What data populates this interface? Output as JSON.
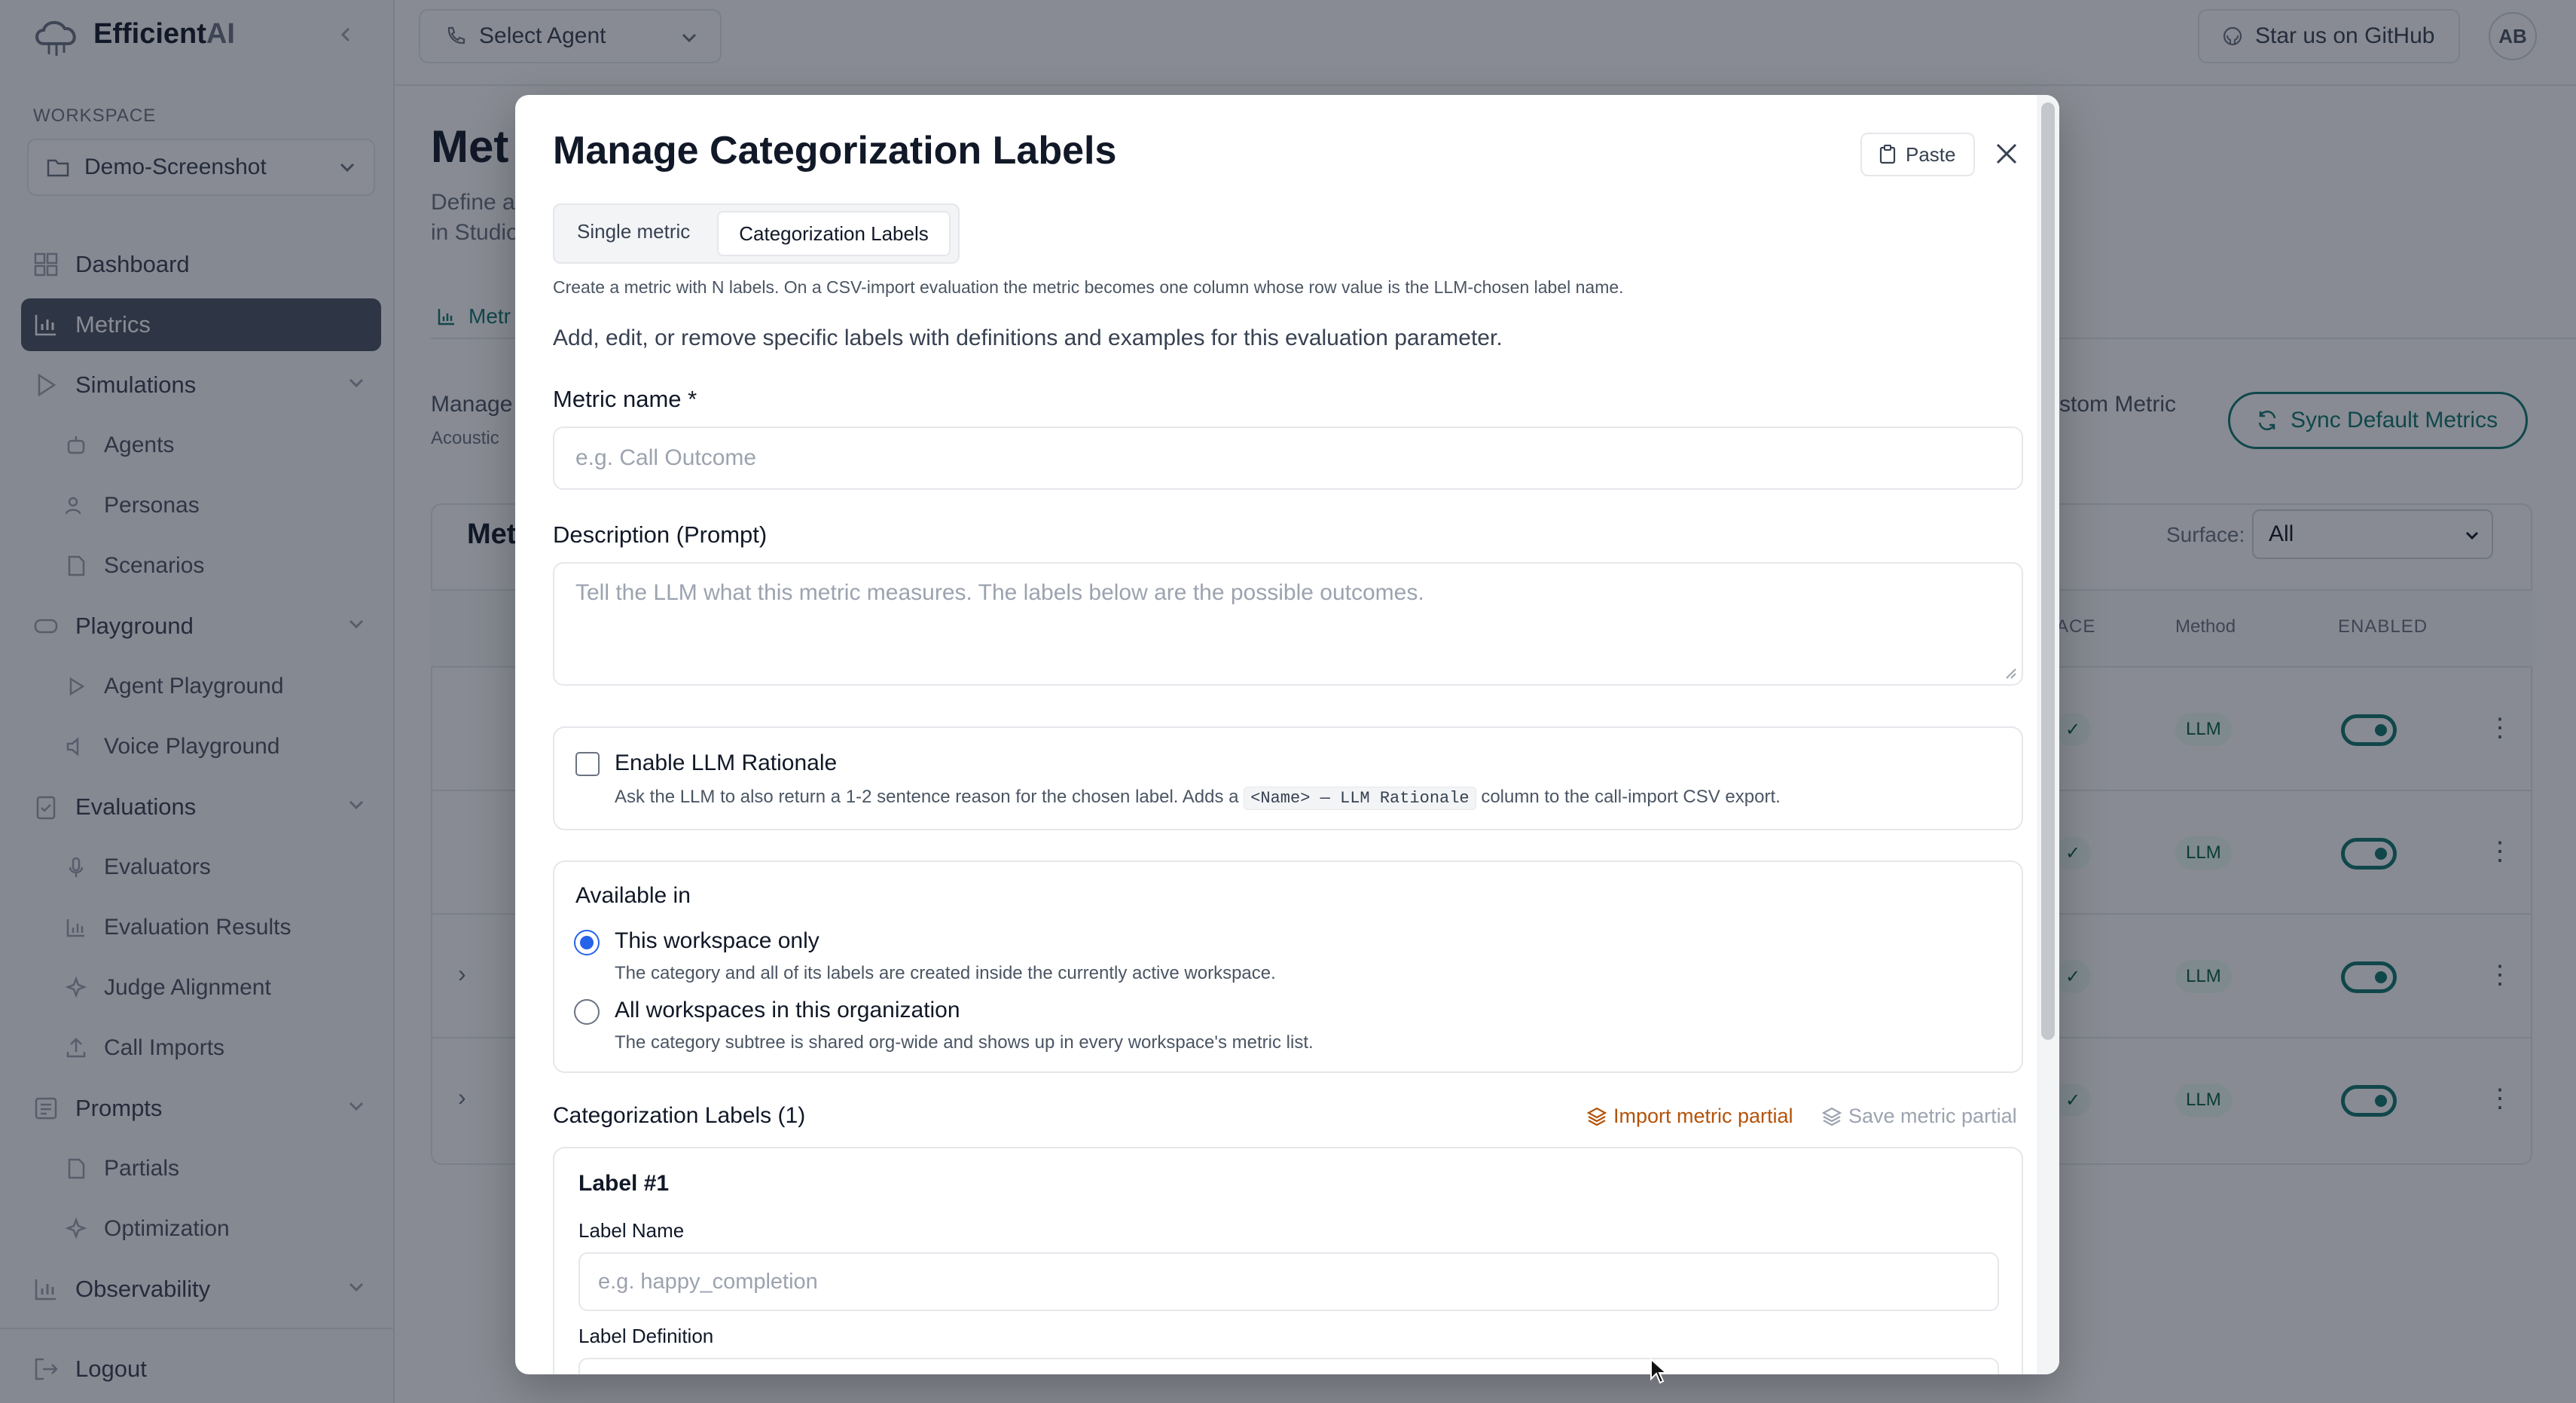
{
  "app": {
    "logo_main": "Efficient",
    "logo_accent": "AI"
  },
  "topbar": {
    "select_agent": "Select Agent",
    "github": "Star us on GitHub",
    "avatar": "AB"
  },
  "sidebar": {
    "workspace_label": "WORKSPACE",
    "workspace_value": "Demo-Screenshot",
    "items": [
      {
        "label": "Dashboard"
      },
      {
        "label": "Metrics"
      },
      {
        "label": "Simulations"
      },
      {
        "label": "Agents"
      },
      {
        "label": "Personas"
      },
      {
        "label": "Scenarios"
      },
      {
        "label": "Playground"
      },
      {
        "label": "Agent Playground"
      },
      {
        "label": "Voice Playground"
      },
      {
        "label": "Evaluations"
      },
      {
        "label": "Evaluators"
      },
      {
        "label": "Evaluation Results"
      },
      {
        "label": "Judge Alignment"
      },
      {
        "label": "Call Imports"
      },
      {
        "label": "Prompts"
      },
      {
        "label": "Partials"
      },
      {
        "label": "Optimization"
      },
      {
        "label": "Observability"
      }
    ],
    "logout": "Logout"
  },
  "page": {
    "title_partial": "Met",
    "desc_line1": "Define a",
    "desc_line2": "in Studio",
    "tab_partial": "Metr",
    "manage_partial": "Manage",
    "acoustic_partial": "Acoustic",
    "section_partial": "Met",
    "custom_metric_partial": "stom Metric",
    "sync_button": "Sync Default Metrics",
    "surface_label": "Surface:",
    "surface_value": "All",
    "col_surface_partial": "ACE",
    "col_method": "Method",
    "col_enabled": "ENABLED",
    "method_badge": "LLM",
    "rows": [
      {},
      {},
      {},
      {}
    ]
  },
  "modal": {
    "title": "Manage Categorization Labels",
    "paste_button": "Paste",
    "tabs": [
      "Single metric",
      "Categorization Labels"
    ],
    "csv_helper": "Create a metric with N labels. On a CSV-import evaluation the metric becomes one column whose row value is the LLM-chosen label name.",
    "subtitle": "Add, edit, or remove specific labels with definitions and examples for this evaluation parameter.",
    "metric_name_label": "Metric name *",
    "metric_name_placeholder": "e.g. Call Outcome",
    "description_label": "Description (Prompt)",
    "description_placeholder": "Tell the LLM what this metric measures. The labels below are the possible outcomes.",
    "rationale_title": "Enable LLM Rationale",
    "rationale_help_before": "Ask the LLM to also return a 1-2 sentence reason for the chosen label. Adds a",
    "rationale_code": "<Name> — LLM Rationale",
    "rationale_help_after": "column to the call-import CSV export.",
    "available_in_label": "Available in",
    "option_workspace": "This workspace only",
    "option_workspace_help": "The category and all of its labels are created inside the currently active workspace.",
    "option_org": "All workspaces in this organization",
    "option_org_help": "The category subtree is shared org-wide and shows up in every workspace's metric list.",
    "labels_heading": "Categorization Labels (1)",
    "import_partial": "Import metric partial",
    "save_partial": "Save metric partial",
    "label_card_title": "Label #1",
    "label_name_label": "Label Name",
    "label_name_placeholder": "e.g. happy_completion",
    "label_definition_label": "Label Definition"
  },
  "colors": {
    "accent": "#0f766e",
    "import_link": "#b45309",
    "active_nav": "#4b5563"
  }
}
